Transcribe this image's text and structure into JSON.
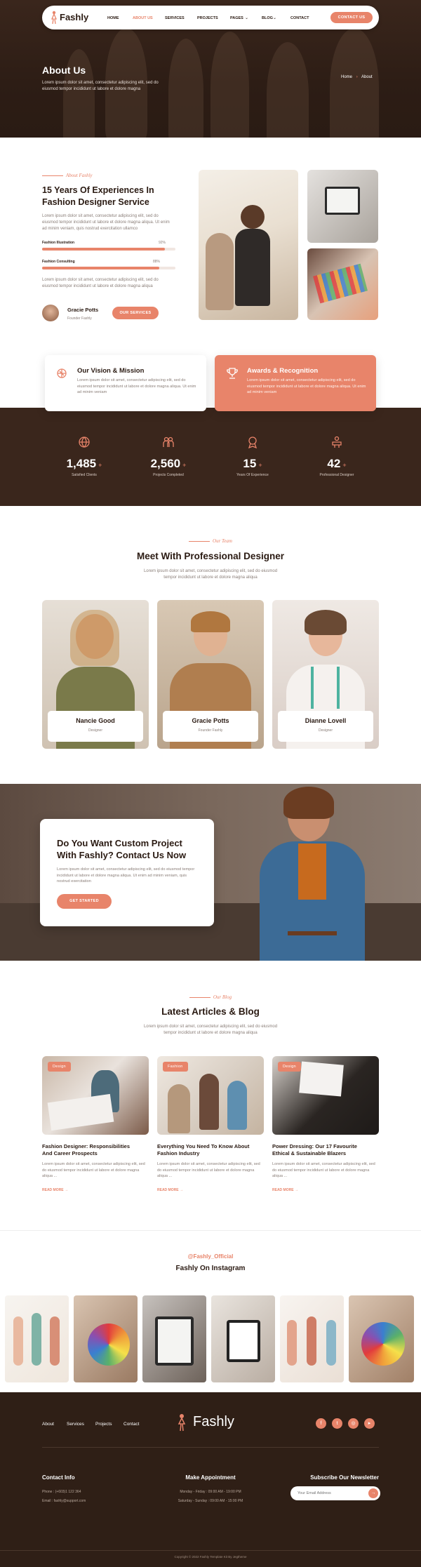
{
  "brand": {
    "name": "Fashly",
    "accent": "#e8846a",
    "dark": "#3a261c"
  },
  "nav": {
    "items": [
      "HOME",
      "ABOUT US",
      "SERVICES",
      "PROJECTS",
      "PAGES",
      "BLOG",
      "CONTACT"
    ],
    "active": "ABOUT US",
    "cta": "CONTACT US"
  },
  "hero": {
    "title": "About Us",
    "text": "Lorem ipsum dolor sit amet, consectetur adipiscing elit, sed do eiusmod tempor incididunt ut labore et dolore magna",
    "breadcrumb_home": "Home",
    "breadcrumb_sep": "›",
    "breadcrumb_current": "About"
  },
  "about": {
    "eyebrow": "About Fashly",
    "title_line1": "15 Years Of Experiences In",
    "title_line2": "Fashion Designer Service",
    "text": "Lorem ipsum dolor sit amet, consectetur adipiscing elit, sed do eiusmod tempor incididunt ut labore et dolore magna aliqua. Ut enim ad minim veniam, quis nostrud exercitation ullamco",
    "skills": [
      {
        "label": "Fashion Illustration",
        "value": "92%",
        "pct": 92
      },
      {
        "label": "Fashion Consulting",
        "value": "88%",
        "pct": 88
      }
    ],
    "text2": "Lorem ipsum dolor sit amet, consectetur adipiscing elit, sed do eiusmod tempor incididunt ut labore et dolore magna aliqua",
    "person_name": "Gracie Potts",
    "person_role": "Founder Fashly",
    "button": "OUR SERVICES"
  },
  "features": [
    {
      "title": "Our Vision & Mission",
      "icon": "compass-icon",
      "text": "Lorem ipsum dolor sit amet, consectetur adipiscing elit, sed do eiusmod tempor incididunt ut labore et dolore magna aliqua. Ut enim ad minim veniam"
    },
    {
      "title": "Awards & Recognition",
      "icon": "trophy-icon",
      "text": "Lorem ipsum dolor sit amet, consectetur adipiscing elit, sed do eiusmod tempor incididunt ut labore et dolore magna aliqua. Ut enim ad minim veniam"
    }
  ],
  "stats": [
    {
      "value": "1,485",
      "plus": "+",
      "label": "Satisfied Clients",
      "icon": "globe-icon"
    },
    {
      "value": "2,560",
      "plus": "+",
      "label": "Projects Completed",
      "icon": "people-icon"
    },
    {
      "value": "15",
      "plus": "+",
      "label": "Years Of Experience",
      "icon": "badge-icon"
    },
    {
      "value": "42",
      "plus": "+",
      "label": "Professional Designer",
      "icon": "team-icon"
    }
  ],
  "team": {
    "eyebrow": "Our Team",
    "title": "Meet With Professional Designer",
    "text": "Lorem ipsum dolor sit amet, consectetur adipiscing elit, sed do eiusmod tempor incididunt ut labore et dolore magna aliqua",
    "members": [
      {
        "name": "Nancie Good",
        "role": "Designer"
      },
      {
        "name": "Gracie Potts",
        "role": "Founder Fashly"
      },
      {
        "name": "Dianne Lovell",
        "role": "Designer"
      }
    ]
  },
  "cta": {
    "title_line1": "Do You Want Custom Project",
    "title_line2": "With Fashly? Contact Us Now",
    "text": "Lorem ipsum dolor sit amet, consectetur adipiscing elit, sed do eiusmod tempor incididunt ut labore et dolore magna aliqua. Ut enim ad minim veniam, quis nostrud exercitation",
    "button": "GET STARTED"
  },
  "blog": {
    "eyebrow": "Our Blog",
    "title": "Latest Articles & Blog",
    "text": "Lorem ipsum dolor sit amet, consectetur adipiscing elit, sed do eiusmod tempor incididunt ut labore et dolore magna aliqua",
    "posts": [
      {
        "tag": "Design",
        "title_line1": "Fashion Designer: Responsibilities",
        "title_line2": "And Career Prospects",
        "text": "Lorem ipsum dolor sit amet, consectetur adipiscing elit, sed do eiusmod tempor incididunt ut labore et dolore magna aliqua ...",
        "more": "READ MORE"
      },
      {
        "tag": "Fashion",
        "title_line1": "Everything You Need To Know About",
        "title_line2": "Fashion Industry",
        "text": "Lorem ipsum dolor sit amet, consectetur adipiscing elit, sed do eiusmod tempor incididunt ut labore et dolore magna aliqua ...",
        "more": "READ MORE"
      },
      {
        "tag": "Design",
        "title_line1": "Power Dressing: Our 17 Favourite",
        "title_line2": "Ethical & Sustainable Blazers",
        "text": "Lorem ipsum dolor sit amet, consectetur adipiscing elit, sed do eiusmod tempor incididunt ut labore et dolore magna aliqua ...",
        "more": "READ MORE"
      }
    ]
  },
  "instagram": {
    "handle": "@Fashly_Official",
    "title": "Fashly On Instagram"
  },
  "footer": {
    "links": [
      "About",
      "Services",
      "Projects",
      "Contact"
    ],
    "brand": "Fashly",
    "contact_title": "Contact Info",
    "phone": "Phone : (+603)1 122 364",
    "email": "Email : fashly@support.com",
    "appt_title": "Make Appointment",
    "hours1": "Monday - Friday : 09:00 AM - 19:00 PM",
    "hours2": "Saturday - Sunday : 09:00 AM - 15:00 PM",
    "news_title": "Subscribe Our Newsletter",
    "news_placeholder": "Your Email Address",
    "copyright": "Copyright © 2022 Fashly Template Kit By Jegtheme"
  }
}
